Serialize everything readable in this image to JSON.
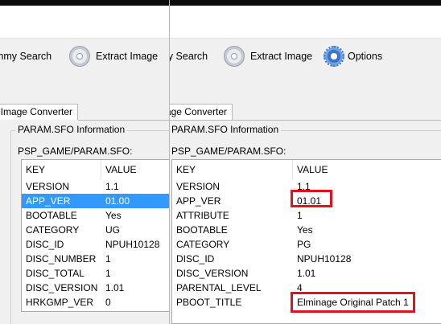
{
  "left_window": {
    "toolbar": {
      "search_label": "Dummy Search",
      "extract_label": "Extract Image"
    },
    "tab_label": "Image Converter",
    "group_title": "PARAM.SFO Information",
    "path_label": "PSP_GAME/PARAM.SFO:",
    "table": {
      "header_key": "KEY",
      "header_value": "VALUE",
      "rows": [
        {
          "key": "VERSION",
          "value": "1.1"
        },
        {
          "key": "APP_VER",
          "value": "01.00"
        },
        {
          "key": "BOOTABLE",
          "value": "Yes"
        },
        {
          "key": "CATEGORY",
          "value": "UG"
        },
        {
          "key": "DISC_ID",
          "value": "NPUH10128"
        },
        {
          "key": "DISC_NUMBER",
          "value": "1"
        },
        {
          "key": "DISC_TOTAL",
          "value": "1"
        },
        {
          "key": "DISC_VERSION",
          "value": "1.01"
        },
        {
          "key": "HRKGMP_VER",
          "value": "0"
        }
      ]
    }
  },
  "right_window": {
    "toolbar": {
      "search_label": "Dummy Search",
      "extract_label": "Extract Image",
      "options_label": "Options"
    },
    "tab_label": "Image Converter",
    "group_title": "PARAM.SFO Information",
    "path_label": "PSP_GAME/PARAM.SFO:",
    "table": {
      "header_key": "KEY",
      "header_value": "VALUE",
      "rows": [
        {
          "key": "VERSION",
          "value": "1.1"
        },
        {
          "key": "APP_VER",
          "value": "01.01"
        },
        {
          "key": "ATTRIBUTE",
          "value": "1"
        },
        {
          "key": "BOOTABLE",
          "value": "Yes"
        },
        {
          "key": "CATEGORY",
          "value": "PG"
        },
        {
          "key": "DISC_ID",
          "value": "NPUH10128"
        },
        {
          "key": "DISC_VERSION",
          "value": "1.01"
        },
        {
          "key": "PARENTAL_LEVEL",
          "value": "4"
        },
        {
          "key": "PBOOT_TITLE",
          "value": "Elminage Original Patch 1"
        }
      ]
    }
  },
  "colors": {
    "selection": "#3399ff",
    "highlight_box": "#e0121f"
  },
  "icons": [
    "cd-disc-icon",
    "gear-icon"
  ]
}
